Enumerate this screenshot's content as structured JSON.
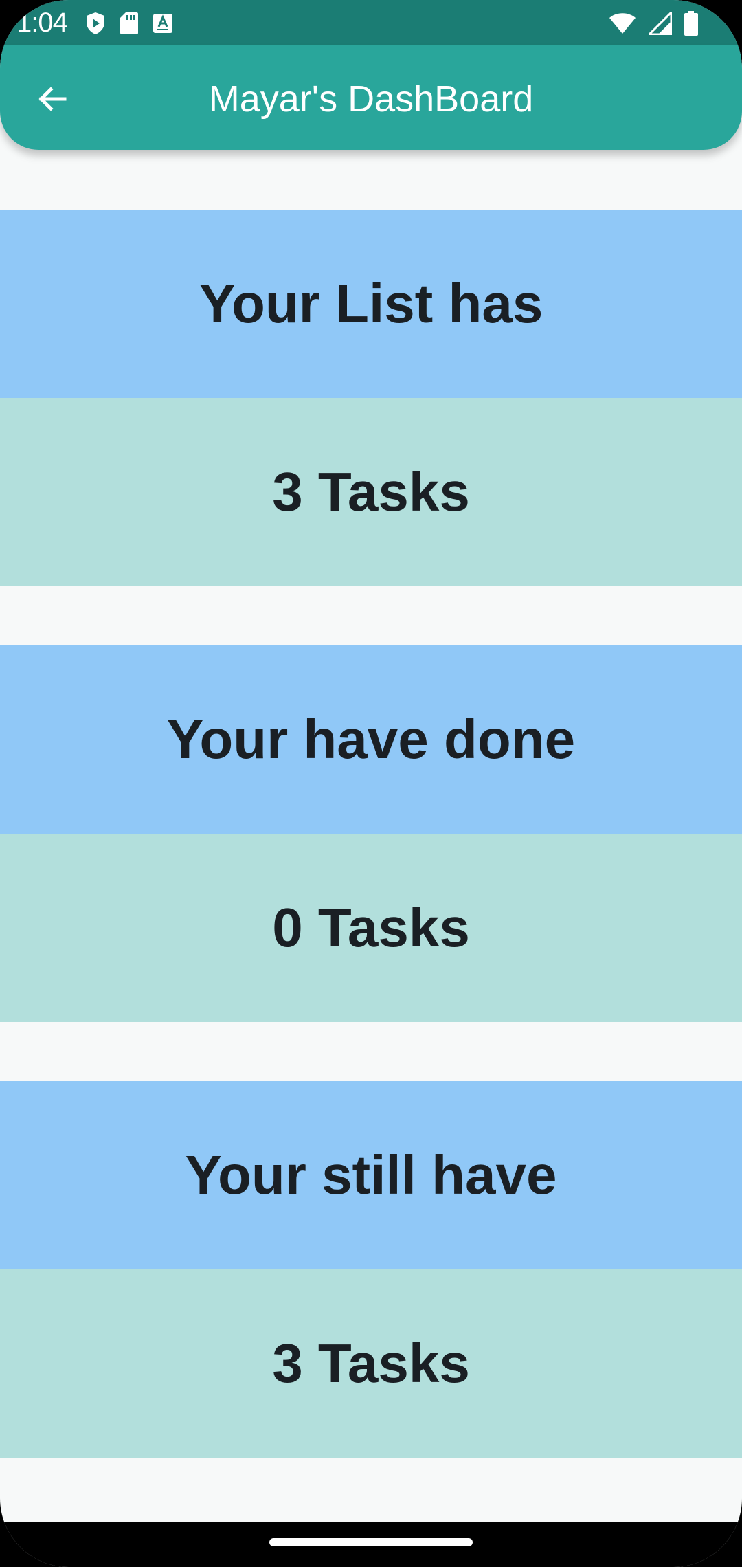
{
  "status_bar": {
    "time": "1:04",
    "left_icons": [
      "shield-play-icon",
      "sd-card-icon",
      "keyboard-a-icon"
    ],
    "right_icons": [
      "wifi-icon",
      "signal-icon",
      "battery-icon"
    ]
  },
  "app_bar": {
    "title": "Mayar's DashBoard",
    "back_icon": "arrow-left-icon"
  },
  "cards": [
    {
      "label": "Your List has",
      "value": "3 Tasks"
    },
    {
      "label": "Your have done",
      "value": "0 Tasks"
    },
    {
      "label": "Your still have",
      "value": "3 Tasks"
    }
  ],
  "colors": {
    "status_bar": "#1b7d74",
    "app_bar": "#29a69b",
    "label_bg": "#90c8f7",
    "value_bg": "#b2dfdc",
    "background": "#f7f9f9"
  }
}
